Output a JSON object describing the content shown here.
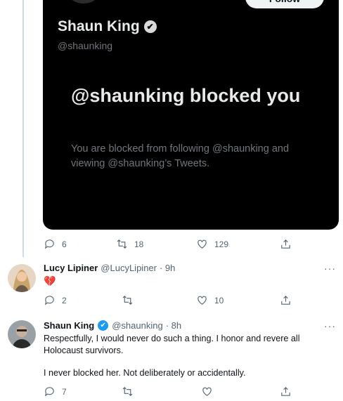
{
  "embedded_card": {
    "follow_label": "Follow",
    "name": "Shaun King",
    "handle": "@shaunking",
    "blocked_title": "@shaunking blocked you",
    "blocked_desc": "You are blocked from following @shaunking and viewing @shaunking’s Tweets."
  },
  "tweet1_actions": {
    "replies": "6",
    "retweets": "18",
    "likes": "129"
  },
  "tweet2": {
    "name": "Lucy Lipiner",
    "handle": "@LucyLipiner",
    "time": "· 9h",
    "body": "💔",
    "actions": {
      "replies": "2",
      "retweets": "",
      "likes": "10"
    }
  },
  "tweet3": {
    "name": "Shaun King",
    "handle": "@shaunking",
    "time": "· 8h",
    "body_p1": "Respectfully, I would never do such a thing. I honor and revere all Holocaust survivors.",
    "body_p2": "I never blocked her. Not deliberately or accidentally.",
    "actions": {
      "replies": "7",
      "retweets": "",
      "likes": ""
    }
  },
  "more_glyph": "···",
  "colors": {
    "accent": "#1d9bf0",
    "muted": "#536471",
    "card_bg": "#000000"
  }
}
